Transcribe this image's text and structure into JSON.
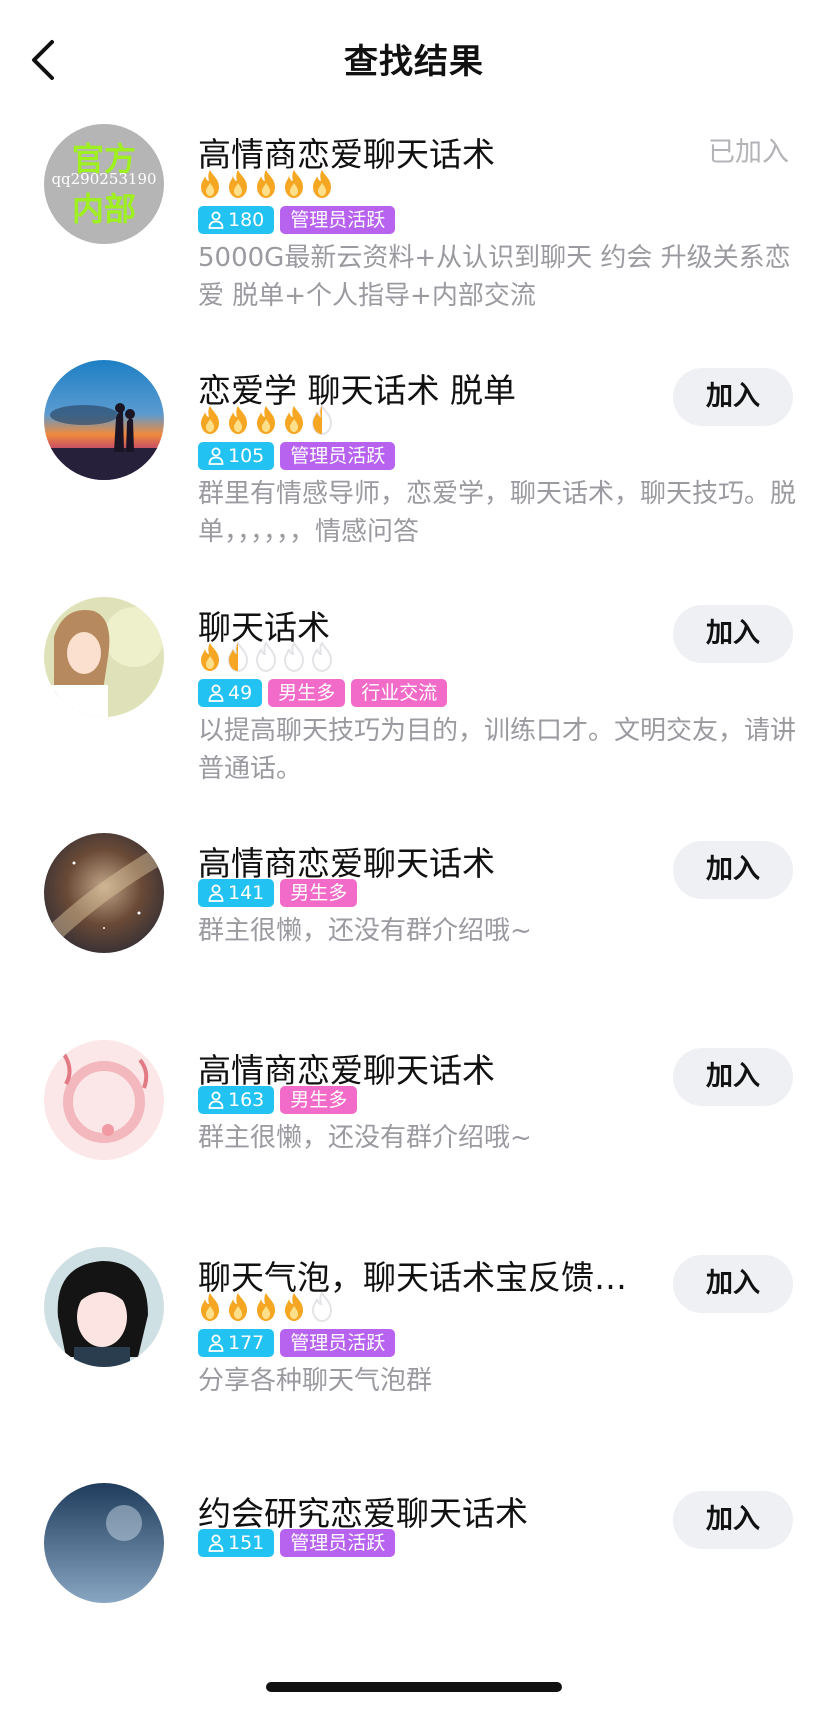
{
  "header": {
    "title": "查找结果"
  },
  "results": [
    {
      "name": "高情商恋爱聊天话术",
      "flames": 5,
      "members": "180",
      "tags": [
        "管理员活跃"
      ],
      "description": "5000G最新云资料+从认识到聊天 约会 升级关系恋爱 脱单+个人指导+内部交流",
      "action": "已加入",
      "joined": true,
      "avatar": {
        "type": "text",
        "line1": "官方",
        "line2": "内部",
        "overlay": "qq290253190",
        "bg": "#b5b5b5",
        "text_color": "#9ef01e"
      }
    },
    {
      "name": "恋爱学 聊天话术 脱单",
      "flames": 4.5,
      "members": "105",
      "tags": [
        "管理员活跃"
      ],
      "description": "群里有情感导师，恋爱学，聊天话术，聊天技巧。脱单，，，，，，情感问答",
      "action": "加入",
      "joined": false,
      "avatar": {
        "type": "sunset"
      }
    },
    {
      "name": "聊天话术",
      "flames": 1.5,
      "members": "49",
      "tags": [
        "男生多",
        "行业交流"
      ],
      "description": "以提高聊天技巧为目的，训练口才。文明交友，请讲普通话。",
      "action": "加入",
      "joined": false,
      "avatar": {
        "type": "girl"
      }
    },
    {
      "name": "高情商恋爱聊天话术",
      "flames": 0,
      "members": "141",
      "tags": [
        "男生多"
      ],
      "description": "群主很懒，还没有群介绍哦~",
      "action": "加入",
      "joined": false,
      "avatar": {
        "type": "galaxy"
      }
    },
    {
      "name": "高情商恋爱聊天话术",
      "flames": 0,
      "members": "163",
      "tags": [
        "男生多"
      ],
      "description": "群主很懒，还没有群介绍哦~",
      "action": "加入",
      "joined": false,
      "avatar": {
        "type": "pink"
      }
    },
    {
      "name": "聊天气泡，聊天话术宝反馈…",
      "flames": 4,
      "members": "177",
      "tags": [
        "管理员活跃"
      ],
      "description": "分享各种聊天气泡群",
      "action": "加入",
      "joined": false,
      "avatar": {
        "type": "anime"
      }
    },
    {
      "name": "约会研究恋爱聊天话术",
      "flames": 0,
      "members": "151",
      "tags": [
        "管理员活跃"
      ],
      "description": "",
      "action": "加入",
      "joined": false,
      "avatar": {
        "type": "sky"
      }
    }
  ],
  "colors": {
    "count_tag": "#22c2f2",
    "admin_tag": "#b862f0",
    "pink_tag": "#f26bc9",
    "flame_on": "#f5a623",
    "flame_off": "#e4e4e8"
  }
}
